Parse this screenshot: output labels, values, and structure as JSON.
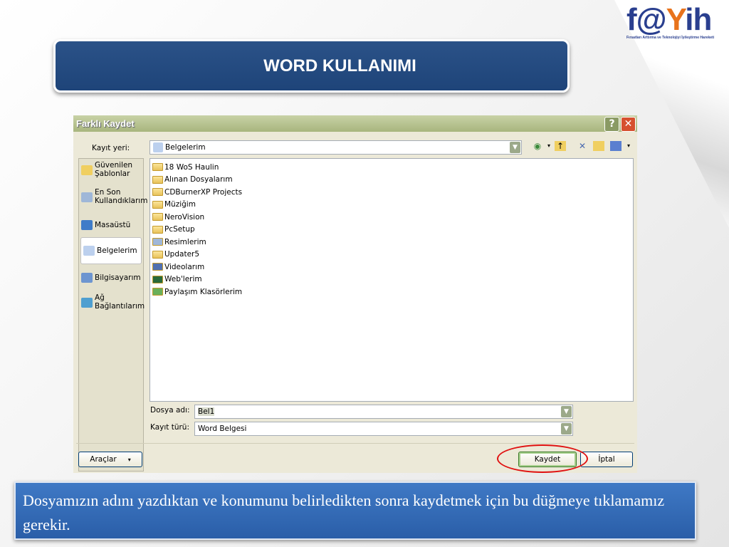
{
  "slide": {
    "title": "WORD KULLANIMI",
    "caption": "Dosyamızın adını yazdıktan ve konumunu belirledikten sonra kaydetmek için bu düğmeye tıklamamız gerekir."
  },
  "logo": {
    "text_a": "f@",
    "text_b": "ih",
    "tagline": "Fırsatları Arttırma ve Teknolojiyi İyileştirme Hareketi"
  },
  "dialog": {
    "title": "Farklı Kaydet",
    "help": "?",
    "close": "✕",
    "save_in_label": "Kayıt yeri:",
    "save_in_value": "Belgelerim",
    "places": [
      {
        "label": "Güvenilen Şablonlar",
        "icon": "folder-icon"
      },
      {
        "label": "En Son Kullandıklarım",
        "icon": "recent-icon"
      },
      {
        "label": "Masaüstü",
        "icon": "desktop-icon"
      },
      {
        "label": "Belgelerim",
        "icon": "documents-icon"
      },
      {
        "label": "Bilgisayarım",
        "icon": "computer-icon"
      },
      {
        "label": "Ağ Bağlantılarım",
        "icon": "network-icon"
      }
    ],
    "files": [
      "18 WoS Haulin",
      "Alınan Dosyalarım",
      "CDBurnerXP Projects",
      "Müziğim",
      "NeroVision",
      "PcSetup",
      "Resimlerim",
      "Updater5",
      "Videolarım",
      "Web'lerim",
      "Paylaşım Klasörlerim"
    ],
    "filename_label": "Dosya adı:",
    "filename_value": "Bel1",
    "filetype_label": "Kayıt türü:",
    "filetype_value": "Word Belgesi",
    "tools_label": "Araçlar",
    "save_button": "Kaydet",
    "cancel_button": "İptal"
  },
  "colors": {
    "banner": "#1e4479",
    "highlight": "#e01010"
  }
}
